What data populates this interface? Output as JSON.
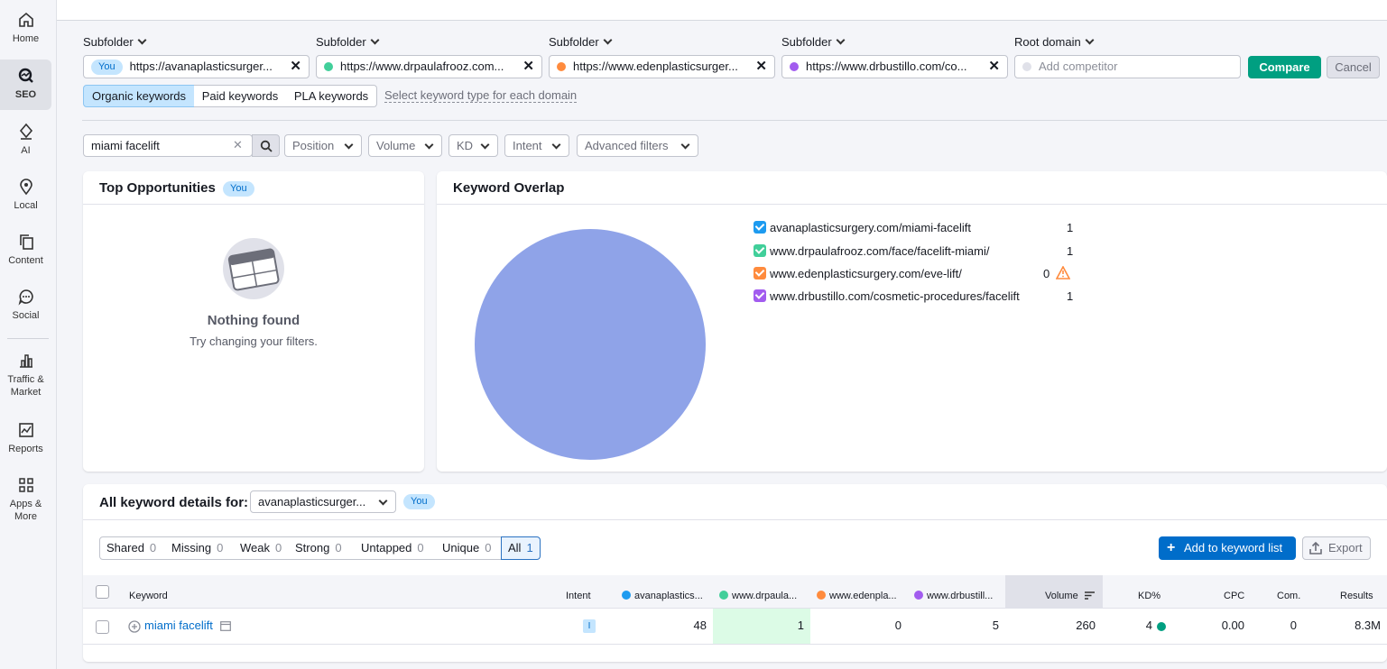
{
  "sidebar": {
    "items": [
      {
        "label": "Home",
        "icon": "home-icon"
      },
      {
        "label": "SEO",
        "icon": "seo-icon"
      },
      {
        "label": "AI",
        "icon": "ai-icon"
      },
      {
        "label": "Local",
        "icon": "location-pin-icon"
      },
      {
        "label": "Content",
        "icon": "content-icon"
      },
      {
        "label": "Social",
        "icon": "chat-bubble-icon"
      },
      {
        "label": "Traffic &",
        "label2": "Market",
        "icon": "bar-chart-icon"
      },
      {
        "label": "Reports",
        "icon": "reports-icon"
      },
      {
        "label": "Apps &",
        "label2": "More",
        "icon": "grid-icon"
      }
    ]
  },
  "domains": [
    {
      "type_label": "Subfolder",
      "badge": "You",
      "url": "https://avanaplasticsurger...",
      "color": null
    },
    {
      "type_label": "Subfolder",
      "url": "https://www.drpaulafrooz.com...",
      "color": "#41cf9a"
    },
    {
      "type_label": "Subfolder",
      "url": "https://www.edenplasticsurger...",
      "color": "#ff8b3d"
    },
    {
      "type_label": "Subfolder",
      "url": "https://www.drbustillo.com/co...",
      "color": "#a25cef"
    },
    {
      "type_label": "Root domain",
      "placeholder": "Add competitor",
      "color": "#e0e1e9"
    }
  ],
  "buttons": {
    "compare": "Compare",
    "cancel": "Cancel"
  },
  "keyword_types": {
    "organic": "Organic keywords",
    "paid": "Paid keywords",
    "pla": "PLA keywords",
    "select_link": "Select keyword type for each domain"
  },
  "filters": {
    "search_value": "miami facelift",
    "position": "Position",
    "volume": "Volume",
    "kd": "KD",
    "intent": "Intent",
    "advanced": "Advanced filters"
  },
  "top_opportunities": {
    "title": "Top Opportunities",
    "badge": "You",
    "empty_title": "Nothing found",
    "empty_sub": "Try changing your filters."
  },
  "keyword_overlap": {
    "title": "Keyword Overlap",
    "pie_color": "#8fa3e8",
    "legend": [
      {
        "label": "avanaplasticsurgery.com/miami-facelift",
        "value": "1",
        "color": "#1d9bf0"
      },
      {
        "label": "www.drpaulafrooz.com/face/facelift-miami/",
        "value": "1",
        "color": "#41cf9a"
      },
      {
        "label": "www.edenplasticsurgery.com/eve-lift/",
        "value": "0",
        "color": "#ff8b3d",
        "warning": true
      },
      {
        "label": "www.drbustillo.com/cosmetic-procedures/facelift",
        "value": "1",
        "color": "#a25cef"
      }
    ]
  },
  "details": {
    "title": "All keyword details for:",
    "selected_domain": "avanaplasticsurger...",
    "badge": "You",
    "segments": [
      {
        "label": "Shared",
        "count": "0"
      },
      {
        "label": "Missing",
        "count": "0"
      },
      {
        "label": "Weak",
        "count": "0"
      },
      {
        "label": "Strong",
        "count": "0"
      },
      {
        "label": "Untapped",
        "count": "0"
      },
      {
        "label": "Unique",
        "count": "0"
      },
      {
        "label": "All",
        "count": "1"
      }
    ],
    "add_to_list": "Add to keyword list",
    "export": "Export",
    "columns": {
      "keyword": "Keyword",
      "intent": "Intent",
      "d1": "avanaplastics...",
      "d2": "www.drpaula...",
      "d3": "www.edenpla...",
      "d4": "www.drbustill...",
      "volume": "Volume",
      "kd": "KD%",
      "cpc": "CPC",
      "com": "Com.",
      "results": "Results"
    },
    "rows": [
      {
        "keyword": "miami facelift",
        "intent": "I",
        "d1": "48",
        "d2": "1",
        "d3": "0",
        "d4": "5",
        "volume": "260",
        "kd": "4",
        "cpc": "0.00",
        "com": "0",
        "results": "8.3M"
      }
    ]
  }
}
